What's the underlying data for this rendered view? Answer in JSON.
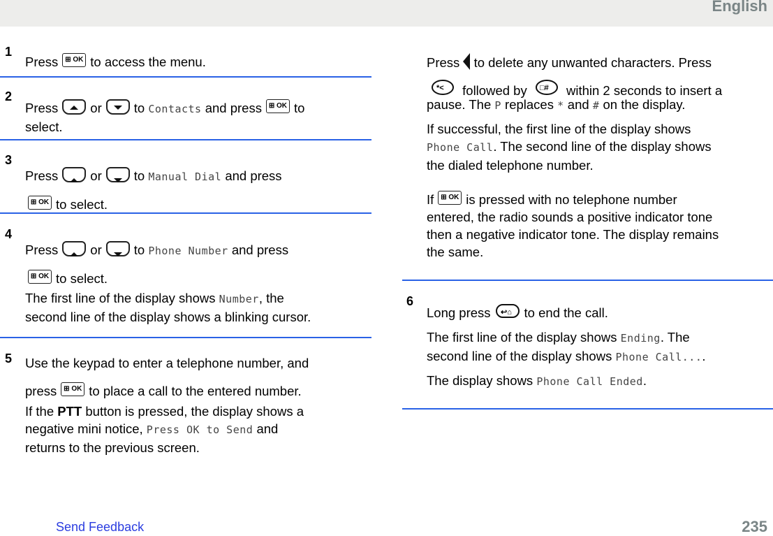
{
  "header": {
    "language": "English"
  },
  "steps": [
    {
      "num": "1",
      "parts": [
        "Press",
        "to access the menu."
      ]
    },
    {
      "num": "2",
      "parts": [
        "Press",
        "or",
        "to",
        "Contacts",
        "and press",
        "to",
        "select."
      ]
    },
    {
      "num": "3",
      "parts": [
        "Press",
        "or",
        "to",
        "Manual Dial",
        "and press",
        "to select."
      ]
    },
    {
      "num": "4",
      "parts": [
        "Press",
        "or",
        "to",
        "Phone Number",
        "and press",
        "to select."
      ],
      "note": [
        "The first line of the display shows",
        "Number",
        ", the",
        "second line of the display shows a blinking cursor."
      ]
    },
    {
      "num": "5",
      "parts": [
        "Use the keypad to enter a telephone number, and",
        "press",
        "to place a call to the entered number."
      ],
      "note": [
        "If the",
        "PTT",
        "button is pressed, the display shows a",
        "negative mini notice,",
        "Press OK to Send",
        "and",
        "returns to the previous screen."
      ]
    },
    {
      "num": "6",
      "parts": [
        "Long press",
        "to end the call."
      ],
      "note1": [
        "The first line of the display shows",
        "Ending",
        ". The",
        "second line of the display shows",
        "Phone Call...",
        "."
      ],
      "note2": [
        "The display shows",
        "Phone Call Ended",
        "."
      ]
    }
  ],
  "right_col": {
    "p1": [
      "Press",
      "to delete any unwanted characters. Press",
      "followed by",
      "within 2 seconds to insert a",
      "pause. The",
      "P",
      "replaces",
      "*",
      "and",
      "#",
      "on the display."
    ],
    "p2": [
      "If successful, the first line of the display shows",
      "Phone Call",
      ". The second line of the display shows",
      "the dialed telephone number."
    ],
    "p3": [
      "If",
      "is pressed with no telephone number",
      "entered, the radio sounds a positive indicator tone",
      "then a negative indicator tone. The display remains",
      "the same."
    ]
  },
  "icons": {
    "ok": "⊞ OK",
    "up": "▲",
    "down": "▼",
    "left": "◀",
    "star": "✱◁",
    "hash": "#",
    "home": "↩⌂"
  },
  "footer": {
    "link": "Send Feedback",
    "page": "235"
  },
  "colors": {
    "rule": "#2a62e6",
    "link": "#2b3de0",
    "header_bg": "#ededeb"
  }
}
